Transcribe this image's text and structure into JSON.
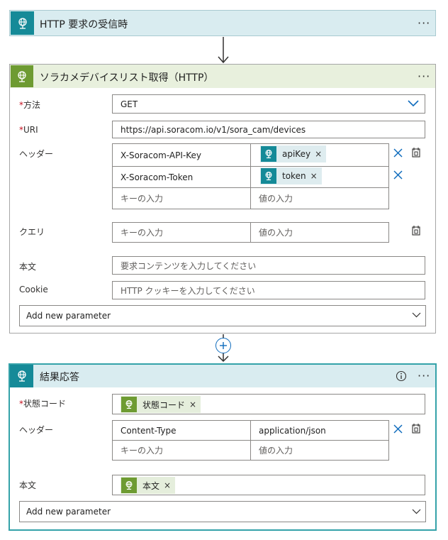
{
  "colors": {
    "trigger_header": "#d9ecf0",
    "trigger_icon": "#158a98",
    "http_header": "#e8f0dd",
    "http_icon": "#6e9b32",
    "response_header": "#d9ecf0",
    "response_icon": "#158a98",
    "accent": "#0f6cbd"
  },
  "trigger": {
    "title": "HTTP 要求の受信時",
    "icon": "globe-icon",
    "more": "···"
  },
  "http_action": {
    "title": "ソラカメデバイスリスト取得（HTTP）",
    "icon": "globe-icon",
    "more": "···",
    "method_label": "方法",
    "method_value": "GET",
    "uri_label": "URI",
    "uri_value": "https://api.soracom.io/v1/sora_cam/devices",
    "headers_label": "ヘッダー",
    "headers": [
      {
        "key": "X-Soracom-API-Key",
        "value_token": "apiKey"
      },
      {
        "key": "X-Soracom-Token",
        "value_token": "token"
      }
    ],
    "key_placeholder": "キーの入力",
    "value_placeholder": "値の入力",
    "query_label": "クエリ",
    "body_label": "本文",
    "body_placeholder": "要求コンテンツを入力してください",
    "cookie_label": "Cookie",
    "cookie_placeholder": "HTTP クッキーを入力してください",
    "add_param": "Add new parameter"
  },
  "connector": {
    "plus": "+"
  },
  "response_action": {
    "title": "結果応答",
    "icon": "globe-icon",
    "more": "···",
    "status_label": "状態コード",
    "status_token": "状態コード",
    "headers_label": "ヘッダー",
    "headers": [
      {
        "key": "Content-Type",
        "value": "application/json"
      }
    ],
    "key_placeholder": "キーの入力",
    "value_placeholder": "値の入力",
    "body_label": "本文",
    "body_token": "本文",
    "add_param": "Add new parameter"
  }
}
